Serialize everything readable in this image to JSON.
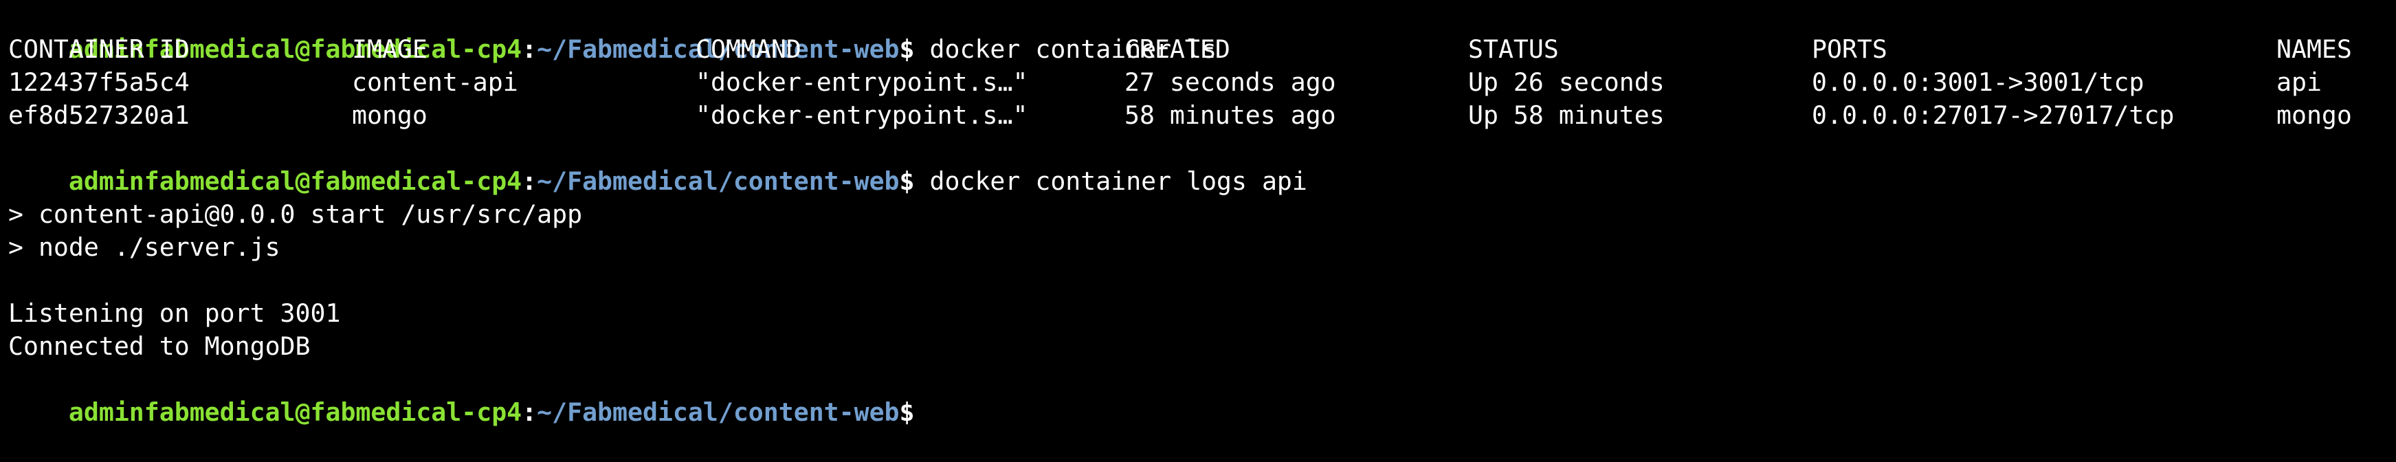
{
  "prompt": {
    "user_host": "adminfabmedical@fabmedical-cp4",
    "separator": ":",
    "path": "~/Fabmedical/content-web",
    "symbol": "$"
  },
  "commands": [
    "docker container ls",
    "docker container logs api",
    ""
  ],
  "table": {
    "headers": [
      "CONTAINER ID",
      "IMAGE",
      "COMMAND",
      "CREATED",
      "STATUS",
      "PORTS",
      "NAMES"
    ],
    "rows": [
      [
        "122437f5a5c4",
        "content-api",
        "\"docker-entrypoint.s…\"",
        "27 seconds ago",
        "Up 26 seconds",
        "0.0.0.0:3001->3001/tcp",
        "api"
      ],
      [
        "ef8d527320a1",
        "mongo",
        "\"docker-entrypoint.s…\"",
        "58 minutes ago",
        "Up 58 minutes",
        "0.0.0.0:27017->27017/tcp",
        "mongo"
      ]
    ]
  },
  "log_output": [
    "",
    "> content-api@0.0.0 start /usr/src/app",
    "> node ./server.js",
    "",
    "Listening on port 3001",
    "Connected to MongoDB"
  ],
  "colors": {
    "background": "#000000",
    "user_host": "#8ae234",
    "path": "#729fcf",
    "text": "#ffffff"
  }
}
